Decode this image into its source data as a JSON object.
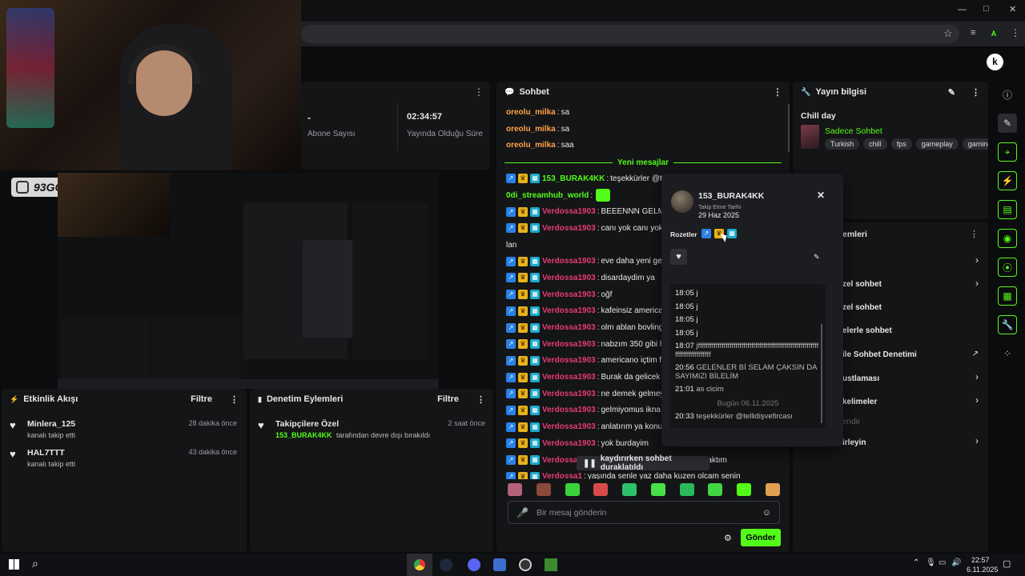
{
  "browser": {
    "window_controls": [
      "—",
      "□",
      "✕"
    ],
    "profile_letter": "A"
  },
  "webcam": {
    "handle": "93GOKMEN"
  },
  "stats": {
    "subs_value": "-",
    "subs_label": "Abone Sayısı",
    "uptime_value": "02:34:57",
    "uptime_label": "Yayında Olduğu Süre"
  },
  "activity": {
    "title": "Etkinlik Akışı",
    "filter": "Filtre",
    "items": [
      {
        "name": "Minlera_125",
        "desc": "kanalı takip etti",
        "time": "28 dakika önce"
      },
      {
        "name": "HAL7TTT",
        "desc": "kanalı takip etti",
        "time": "43 dakika önce"
      }
    ]
  },
  "mod_actions": {
    "title": "Denetim Eylemleri",
    "filter": "Filtre",
    "item": {
      "name": "Takipçilere Özel",
      "user": "153_BURAK4KK",
      "desc": "tarafından devre dışı bırakıldı",
      "time": "2 saat önce"
    }
  },
  "chat": {
    "title": "Sohbet",
    "old_messages": [
      {
        "user": "oreolu_milka",
        "text": "sa"
      },
      {
        "user": "oreolu_milka",
        "text": "sa"
      },
      {
        "user": "oreolu_milka",
        "text": "saa"
      }
    ],
    "new_divider": "Yeni mesajlar",
    "messages": [
      {
        "user": "153_BURAK4KK",
        "text": "teşekkürler @tel",
        "badges": true,
        "color": "green"
      },
      {
        "user": "0di_streamhub_world",
        "text": "",
        "badges": false,
        "color": "green",
        "emote": true
      },
      {
        "user": "Verdossa1903",
        "text": "BEEENNN GELMİŞ",
        "badges": true,
        "color": "pink"
      },
      {
        "user": "Verdossa1903",
        "text": "canı yok canı yok",
        "badges": true,
        "color": "pink"
      },
      {
        "user": "",
        "text": "lan",
        "badges": false,
        "color": "pink"
      },
      {
        "user": "Verdossa1903",
        "text": "eve daha yeni geld",
        "badges": true,
        "color": "pink"
      },
      {
        "user": "Verdossa1903",
        "text": "disardaydim ya",
        "badges": true,
        "color": "pink"
      },
      {
        "user": "Verdossa1903",
        "text": "oğf",
        "badges": true,
        "color": "pink"
      },
      {
        "user": "Verdossa1903",
        "text": "kafeinsiz americar",
        "badges": true,
        "color": "pink"
      },
      {
        "user": "Verdossa1903",
        "text": "olm ablan bovling",
        "badges": true,
        "color": "pink"
      },
      {
        "user": "Verdossa1903",
        "text": "nabzım 350 gibi h",
        "badges": true,
        "color": "pink"
      },
      {
        "user": "Verdossa1903",
        "text": "americano içtim fe",
        "badges": true,
        "color": "pink"
      },
      {
        "user": "Verdossa1903",
        "text": "Burak da gelicek",
        "badges": true,
        "color": "pink"
      },
      {
        "user": "Verdossa1903",
        "text": "ne demek gelmey",
        "badges": true,
        "color": "pink"
      },
      {
        "user": "Verdossa1903",
        "text": "gelmiyomus ikna o",
        "badges": true,
        "color": "pink"
      },
      {
        "user": "Verdossa1903",
        "text": "anlatırım ya konuş",
        "badges": true,
        "color": "pink"
      },
      {
        "user": "Verdossa1903",
        "text": "yok burdayim",
        "badges": true,
        "color": "pink"
      },
      {
        "user": "Verdossa1903",
        "text": "heee ben senin bu ifadeni alıcaktım",
        "badges": true,
        "color": "pink"
      },
      {
        "user": "Verdossa1",
        "text": "yaşında senle yaz daha kuzen olcam senin",
        "badges": true,
        "color": "pink"
      }
    ],
    "paused": "kaydırırken sohbet duraklatıldı",
    "input_placeholder": "Bir mesaj gönderin",
    "send": "Gönder"
  },
  "stream_info": {
    "title": "Yayın bilgisi",
    "stream_title": "Chill day",
    "category": "Sadece Sohbet",
    "tags": [
      "Turkish",
      "chill",
      "fps",
      "gameplay",
      "gaming"
    ]
  },
  "chat_settings": {
    "title": "emleri",
    "rows": [
      "",
      "zel sohbet",
      "zel sohbet",
      "elerle sohbet",
      "ile Sohbet Denetimi",
      "ustlaması",
      "kelimeler",
      "endir",
      "irleyin"
    ]
  },
  "user_card": {
    "username": "153_BURAK4KK",
    "follow_label": "Takip Etme Tarihi",
    "follow_date": "29 Haz 2025",
    "badges_label": "Rozetler",
    "history": [
      {
        "time": "18:05",
        "text": "j"
      },
      {
        "time": "18:05",
        "text": "j"
      },
      {
        "time": "18:05",
        "text": "j"
      },
      {
        "time": "18:05",
        "text": "j"
      },
      {
        "time": "18:07",
        "text": "jfffffffffffffffffffffffffffffffffffffffffffffffffffffffffffffffffffffffffffffff"
      },
      {
        "time": "20:56",
        "text": "GELENLER Bİ SELAM ÇAKSIN DA SAYIMIZI BİLELİM"
      },
      {
        "time": "21:01",
        "text": "as cicim"
      }
    ],
    "today_divider": "Bugün 06.11.2025",
    "last": {
      "time": "20:33",
      "text": "teşekkürler @tellidişvefircası"
    }
  },
  "taskbar": {
    "time": "22:57",
    "date": "6.11.2025"
  }
}
